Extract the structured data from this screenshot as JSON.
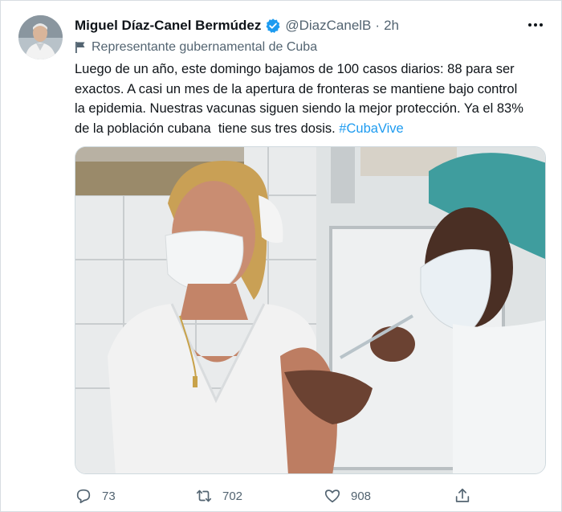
{
  "tweet": {
    "author_name": "Miguel Díaz-Canel Bermúdez",
    "handle": "@DiazCanelB",
    "separator": "·",
    "time": "2h",
    "label": "Representante gubernamental de Cuba",
    "text_line1": "Luego de un año, este domingo bajamos de 100 casos diarios: 88 para ser",
    "text_line2": "exactos. A casi un mes de la apertura de fronteras se mantiene bajo control",
    "text_line3": "la epidemia. Nuestras vacunas siguen siendo la mejor protección. Ya el 83%",
    "text_line4": "de la población cubana  tiene sus tres dosis. ",
    "hashtag": "#CubaVive",
    "replies": "73",
    "retweets": "702",
    "likes": "908"
  },
  "icons": {
    "verified": "verified-badge-icon",
    "label": "flag-icon",
    "reply": "reply-icon",
    "retweet": "retweet-icon",
    "like": "heart-icon",
    "share": "share-icon",
    "more": "more-options-icon"
  },
  "colors": {
    "accent": "#1d9bf0",
    "secondary_text": "#536471",
    "primary_text": "#0f1419"
  }
}
